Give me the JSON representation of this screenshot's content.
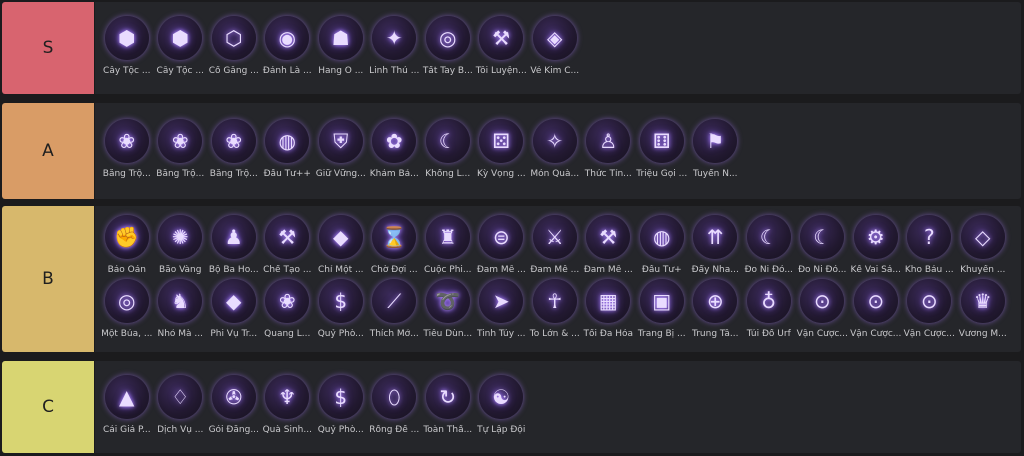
{
  "tiers": [
    {
      "label": "S",
      "color": "#d8646f",
      "items": [
        {
          "name": "Cây Tộc ...",
          "icon": "totem-cube-icon"
        },
        {
          "name": "Cây Tộc ...",
          "icon": "totem-cube-icon"
        },
        {
          "name": "Cố Gắng ...",
          "icon": "hexagon-figure-icon"
        },
        {
          "name": "Đánh Là ...",
          "icon": "orb-icon"
        },
        {
          "name": "Hang Ổ ...",
          "icon": "monster-head-icon"
        },
        {
          "name": "Linh Thú ...",
          "icon": "creature-icon"
        },
        {
          "name": "Tất Tay B...",
          "icon": "poker-chip-icon"
        },
        {
          "name": "Tôi Luyện...",
          "icon": "anvil-icon"
        },
        {
          "name": "Vé Kim C...",
          "icon": "ticket-icon"
        }
      ]
    },
    {
      "label": "A",
      "color": "#d99c66",
      "items": [
        {
          "name": "Băng Trộ...",
          "icon": "paw-icon"
        },
        {
          "name": "Băng Trộ...",
          "icon": "paw-icon"
        },
        {
          "name": "Băng Trộ...",
          "icon": "paw-icon"
        },
        {
          "name": "Đầu Tư++",
          "icon": "coins-icon"
        },
        {
          "name": "Giữ Vững...",
          "icon": "shield-icon"
        },
        {
          "name": "Khảm Bả...",
          "icon": "lotus-icon"
        },
        {
          "name": "Khống L...",
          "icon": "crescent-icon"
        },
        {
          "name": "Kỳ Vọng ...",
          "icon": "dice-icon"
        },
        {
          "name": "Món Quà...",
          "icon": "gift-icon"
        },
        {
          "name": "Thức Tỉn...",
          "icon": "awakening-icon"
        },
        {
          "name": "Triệu Gọi ...",
          "icon": "summon-dice-icon"
        },
        {
          "name": "Tuyển N...",
          "icon": "helmet-flag-icon"
        }
      ]
    },
    {
      "label": "B",
      "color": "#d7b86c",
      "items": [
        {
          "name": "Báo Oán",
          "icon": "fist-icon"
        },
        {
          "name": "Bão Vàng",
          "icon": "storm-icon"
        },
        {
          "name": "Bộ Ba Ho...",
          "icon": "trio-icon"
        },
        {
          "name": "Chế Tạo ...",
          "icon": "anvil-icon"
        },
        {
          "name": "Chỉ Một ...",
          "icon": "cube-icon"
        },
        {
          "name": "Chờ Đợi ...",
          "icon": "hourglass-icon"
        },
        {
          "name": "Cuộc Phi...",
          "icon": "figure-shield-icon"
        },
        {
          "name": "Đam Mê ...",
          "icon": "belt-icon"
        },
        {
          "name": "Đam Mê ...",
          "icon": "sword-icon"
        },
        {
          "name": "Đam Mê ...",
          "icon": "hammer-icon"
        },
        {
          "name": "Đầu Tư+",
          "icon": "coins-icon"
        },
        {
          "name": "Đẩy Nha...",
          "icon": "arrows-up-icon"
        },
        {
          "name": "Đo Ni Đó...",
          "icon": "crescent-icon"
        },
        {
          "name": "Đo Ni Đó...",
          "icon": "crescent-icon"
        },
        {
          "name": "Kề Vai Sá...",
          "icon": "gear-icon"
        },
        {
          "name": "Kho Báu ...",
          "icon": "mystery-box-icon"
        },
        {
          "name": "Khuyến ...",
          "icon": "diamond-arrow-icon"
        },
        {
          "name": "Một Búa, ...",
          "icon": "vortex-icon"
        },
        {
          "name": "Nhỏ Mà ...",
          "icon": "helmet-icon"
        },
        {
          "name": "Phi Vụ Tr...",
          "icon": "cube-icon"
        },
        {
          "name": "Quang L...",
          "icon": "paw-icon"
        },
        {
          "name": "Quỷ Phò...",
          "icon": "money-bag-icon"
        },
        {
          "name": "Thích Mở...",
          "icon": "slash-icon"
        },
        {
          "name": "Tiêu Dùn...",
          "icon": "swirl-icon"
        },
        {
          "name": "Tinh Túy ...",
          "icon": "dash-icon"
        },
        {
          "name": "To Lớn & ...",
          "icon": "figure-icon"
        },
        {
          "name": "Tối Đa Hóa",
          "icon": "blocks-icon"
        },
        {
          "name": "Trang Bị ...",
          "icon": "open-box-icon"
        },
        {
          "name": "Trung Tâ...",
          "icon": "ring-icon"
        },
        {
          "name": "Túi Đồ Urf",
          "icon": "bag-icon"
        },
        {
          "name": "Vận Cược...",
          "icon": "coin-toss-icon"
        },
        {
          "name": "Vận Cược...",
          "icon": "coin-toss-icon"
        },
        {
          "name": "Vận Cược...",
          "icon": "coin-toss-icon"
        },
        {
          "name": "Vương M...",
          "icon": "crown-spoon-icon"
        }
      ]
    },
    {
      "label": "C",
      "color": "#d8d572",
      "items": [
        {
          "name": "Cái Giá P...",
          "icon": "pyramid-icon"
        },
        {
          "name": "Dịch Vụ ...",
          "icon": "service-icon"
        },
        {
          "name": "Gói Đăng...",
          "icon": "spiral-dice-icon"
        },
        {
          "name": "Quà Sinh...",
          "icon": "ringed-orb-icon"
        },
        {
          "name": "Quỷ Phò...",
          "icon": "money-bag-icon"
        },
        {
          "name": "Rồng Đế ...",
          "icon": "egg-icon"
        },
        {
          "name": "Toàn Thầ...",
          "icon": "spin-arrow-icon"
        },
        {
          "name": "Tự Lập Đội",
          "icon": "meditate-icon"
        }
      ]
    }
  ]
}
